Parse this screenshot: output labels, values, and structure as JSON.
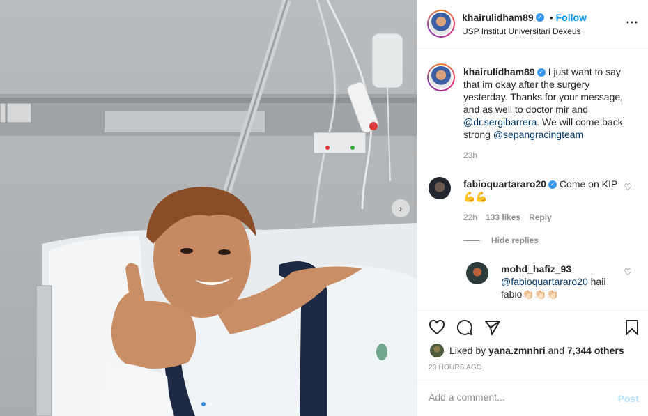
{
  "header": {
    "username": "khairulidham89",
    "verified_icon": "verified-badge-icon",
    "separator": "•",
    "follow_label": "Follow",
    "location": "USP Institut Universitari Dexeus",
    "more_icon": "⋯"
  },
  "carousel": {
    "next_icon": "›",
    "slides_total": 2,
    "active_slide": 1
  },
  "caption": {
    "username": "khairulidham89",
    "text_part1": " I just want to say that im okay after the surgery yesterday. Thanks for your message, and as well to doctor mir and ",
    "mention1": "@dr.sergibarrera",
    "text_part2": ". We will come back strong ",
    "mention2": "@sepangracingteam",
    "time": "23h"
  },
  "comments": [
    {
      "username": "fabioquartararo20",
      "text": " Come on KIP 💪💪",
      "time": "22h",
      "likes": "133 likes",
      "reply_label": "Reply",
      "hide_replies_label": "Hide replies"
    }
  ],
  "replies": [
    {
      "username": "mohd_hafiz_93",
      "mention": "@fabioquartararo20",
      "text": " haii fabio👏🏻👏🏻👏🏻"
    }
  ],
  "likes": {
    "prefix": "Liked by ",
    "user": "yana.zmnhri",
    "middle": " and ",
    "others": "7,344 others"
  },
  "posted": "23 HOURS AGO",
  "add_comment": {
    "placeholder": "Add a comment...",
    "post_label": "Post"
  },
  "colors": {
    "accent": "#0095f6",
    "muted": "#8e8e8e",
    "post_disabled": "#b2dffc"
  }
}
